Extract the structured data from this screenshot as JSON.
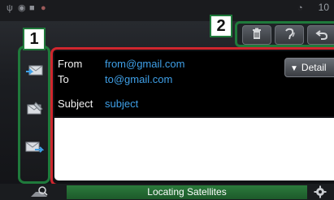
{
  "status_bar": {
    "time": "10"
  },
  "badges": {
    "one": "1",
    "two": "2"
  },
  "sidebar": {
    "items": [
      {
        "icon": "mail-receive-icon"
      },
      {
        "icon": "mail-compose-icon"
      },
      {
        "icon": "mail-forward-icon"
      }
    ]
  },
  "toolbar": {
    "items": [
      {
        "icon": "trash-icon"
      },
      {
        "icon": "voice-read-icon"
      },
      {
        "icon": "back-icon"
      }
    ]
  },
  "message": {
    "from_label": "From",
    "from_value": "from@gmail.com",
    "to_label": "To",
    "to_value": "to@gmail.com",
    "subject_label": "Subject",
    "subject_value": "subject",
    "detail_label": "Detail"
  },
  "bottom_bar": {
    "status_text": "Locating Satellites"
  },
  "colors": {
    "outline_green": "#1f7a3b",
    "outline_red": "#d0262e",
    "link_blue": "#3fa0e8"
  }
}
